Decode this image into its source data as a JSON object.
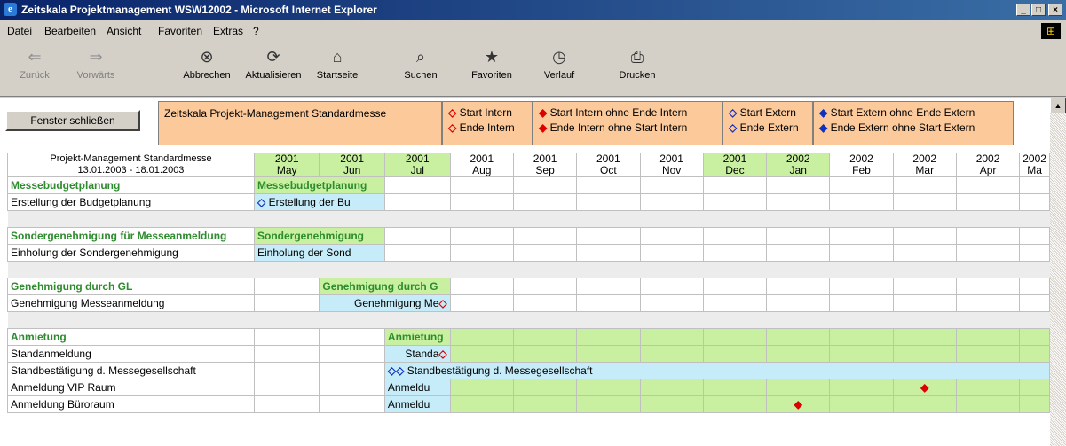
{
  "window": {
    "title": "Zeitskala Projektmanagement WSW12002 - Microsoft Internet Explorer",
    "controls": [
      "_",
      "□",
      "×"
    ]
  },
  "menu": [
    "Datei",
    "Bearbeiten",
    "Ansicht",
    "Favoriten",
    "Extras",
    "?"
  ],
  "toolbar": {
    "back": "Zurück",
    "forward": "Vorwärts",
    "stop": "Abbrechen",
    "refresh": "Aktualisieren",
    "home": "Startseite",
    "search": "Suchen",
    "favorites": "Favoriten",
    "history": "Verlauf",
    "print": "Drucken"
  },
  "header": {
    "close_button": "Fenster schließen",
    "title": "Zeitskala Projekt-Management Standardmesse",
    "legend1": [
      "Start Intern",
      "Ende Intern"
    ],
    "legend2": [
      "Start Intern ohne Ende Intern",
      "Ende Intern ohne Start Intern"
    ],
    "legend3": [
      "Start Extern",
      "Ende Extern"
    ],
    "legend4": [
      "Start Extern ohne Ende Extern",
      "Ende Extern ohne Start Extern"
    ]
  },
  "grid": {
    "project_title": "Projekt-Management Standardmesse",
    "project_dates": "13.01.2003 - 18.01.2003",
    "months": [
      {
        "year": "2001",
        "month": "May"
      },
      {
        "year": "2001",
        "month": "Jun"
      },
      {
        "year": "2001",
        "month": "Jul"
      },
      {
        "year": "2001",
        "month": "Aug"
      },
      {
        "year": "2001",
        "month": "Sep"
      },
      {
        "year": "2001",
        "month": "Oct"
      },
      {
        "year": "2001",
        "month": "Nov"
      },
      {
        "year": "2001",
        "month": "Dec"
      },
      {
        "year": "2002",
        "month": "Jan"
      },
      {
        "year": "2002",
        "month": "Feb"
      },
      {
        "year": "2002",
        "month": "Mar"
      },
      {
        "year": "2002",
        "month": "Apr"
      },
      {
        "year": "2002",
        "month": "Ma"
      }
    ],
    "group1": {
      "label": "Messebudgetplanung",
      "bar": "Messebudgetplanung"
    },
    "task1": {
      "label": "Erstellung der Budgetplanung",
      "bar": "Erstellung der Bu"
    },
    "group2": {
      "label": "Sondergenehmigung für Messeanmeldung",
      "bar": "Sondergenehmigung"
    },
    "task2": {
      "label": "Einholung der Sondergenehmigung",
      "bar": "Einholung der Sond"
    },
    "group3": {
      "label": "Genehmigung durch GL",
      "bar": "Genehmigung durch G"
    },
    "task3": {
      "label": "Genehmigung Messeanmeldung",
      "bar": "Genehmigung Me"
    },
    "group4": {
      "label": "Anmietung",
      "bar": "Anmietung"
    },
    "task4": {
      "label": "Standanmeldung",
      "bar": "Standa"
    },
    "task5": {
      "label": "Standbestätigung d. Messegesellschaft",
      "bar": "Standbestätigung d. Messegesellschaft"
    },
    "task6": {
      "label": "Anmeldung VIP Raum",
      "bar": "Anmeldu"
    },
    "task7": {
      "label": "Anmeldung Büroraum",
      "bar": "Anmeldu"
    }
  },
  "colors": {
    "titlebar": "#0a246a",
    "header_band": "#fbc99a",
    "green_bar": "#c8f0a0",
    "blue_bar": "#c6ecf9",
    "group_text": "#2e8b2e"
  }
}
